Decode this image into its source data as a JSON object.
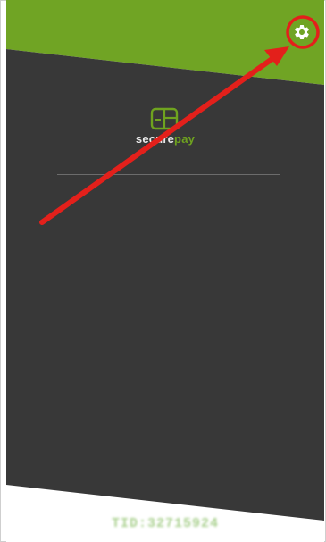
{
  "app": {
    "brand": {
      "part1": "secure",
      "part2": "pay"
    },
    "terminal_id": "TID:32715924"
  },
  "icons": {
    "settings": "gear-icon",
    "logo": "card-logo-icon"
  },
  "colors": {
    "accent_green": "#6fa31f",
    "dark_panel": "#373737",
    "annotation_red": "#e3201b"
  }
}
